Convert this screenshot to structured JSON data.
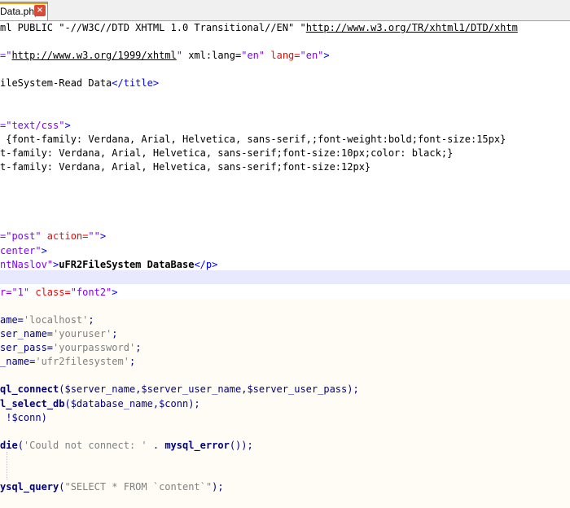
{
  "tab": {
    "label": "Data.php",
    "close_icon": "×"
  },
  "lines": [
    [
      {
        "t": "ml PUBLIC \"-//W3C//DTD XHTML 1.0 Transitional//EN\" ",
        "c": "plain"
      },
      {
        "t": "\"",
        "c": "plain"
      },
      {
        "t": "http://www.w3.org/TR/xhtml1/DTD/xhtm",
        "c": "url"
      }
    ],
    [],
    [
      {
        "t": "=\"",
        "c": "str"
      },
      {
        "t": "http://www.w3.org/1999/xhtml",
        "c": "url"
      },
      {
        "t": "\"",
        "c": "str"
      },
      {
        "t": " xml:lang=",
        "c": "plain"
      },
      {
        "t": "\"en\"",
        "c": "str"
      },
      {
        "t": " lang=",
        "c": "attr"
      },
      {
        "t": "\"en\"",
        "c": "str"
      },
      {
        "t": ">",
        "c": "tag"
      }
    ],
    [],
    [
      {
        "t": "ileSystem-Read Data",
        "c": "plain"
      },
      {
        "t": "</title>",
        "c": "tag"
      }
    ],
    [],
    [],
    [
      {
        "t": "=\"text/css\"",
        "c": "str"
      },
      {
        "t": ">",
        "c": "tag"
      }
    ],
    [
      {
        "t": " {font-family: Verdana, Arial, Helvetica, sans-serif,;font-weight:bold;font-size:15px}",
        "c": "plain"
      }
    ],
    [
      {
        "t": "t-family: Verdana, Arial, Helvetica, sans-serif;font-size:10px;color: black;}",
        "c": "plain"
      }
    ],
    [
      {
        "t": "t-family: Verdana, Arial, Helvetica, sans-serif;font-size:12px}",
        "c": "plain"
      }
    ],
    [],
    [],
    [],
    [],
    [
      {
        "t": "=\"post\"",
        "c": "str"
      },
      {
        "t": " action=",
        "c": "attr"
      },
      {
        "t": "\"\"",
        "c": "str"
      },
      {
        "t": ">",
        "c": "tag"
      }
    ],
    [
      {
        "t": "center\"",
        "c": "str"
      },
      {
        "t": ">",
        "c": "tag"
      }
    ],
    [
      {
        "t": "ntNaslov\"",
        "c": "str"
      },
      {
        "t": ">",
        "c": "tag"
      },
      {
        "t": "uFR2FileSystem DataBase",
        "c": "txt"
      },
      {
        "t": "</p>",
        "c": "tag"
      }
    ],
    [],
    [
      {
        "t": "r=\"1\"",
        "c": "str"
      },
      {
        "t": " class=",
        "c": "attr"
      },
      {
        "t": "\"font2\"",
        "c": "str"
      },
      {
        "t": ">",
        "c": "tag"
      }
    ],
    [],
    [
      {
        "t": "ame=",
        "c": "var"
      },
      {
        "t": "'localhost'",
        "c": "sq"
      },
      {
        "t": ";",
        "c": "var"
      }
    ],
    [
      {
        "t": "ser_name=",
        "c": "var"
      },
      {
        "t": "'youruser'",
        "c": "sq"
      },
      {
        "t": ";",
        "c": "var"
      }
    ],
    [
      {
        "t": "ser_pass=",
        "c": "var"
      },
      {
        "t": "'yourpassword'",
        "c": "sq"
      },
      {
        "t": ";",
        "c": "var"
      }
    ],
    [
      {
        "t": "_name=",
        "c": "var"
      },
      {
        "t": "'ufr2filesystem'",
        "c": "sq"
      },
      {
        "t": ";",
        "c": "var"
      }
    ],
    [],
    [
      {
        "t": "ql_connect",
        "c": "kw"
      },
      {
        "t": "($server_name,$server_user_name,$server_user_pass);",
        "c": "var"
      }
    ],
    [
      {
        "t": "l_select_db",
        "c": "kw"
      },
      {
        "t": "($database_name,$conn);",
        "c": "var"
      }
    ],
    [
      {
        "t": " !$conn)",
        "c": "var"
      }
    ],
    [],
    [
      {
        "t": "die",
        "c": "kw"
      },
      {
        "t": "(",
        "c": "var"
      },
      {
        "t": "'Could not connect: '",
        "c": "sq"
      },
      {
        "t": " . ",
        "c": "var"
      },
      {
        "t": "mysql_error",
        "c": "kw"
      },
      {
        "t": "());",
        "c": "var"
      }
    ],
    [],
    [],
    [
      {
        "t": "ysql_query",
        "c": "kw"
      },
      {
        "t": "(",
        "c": "var"
      },
      {
        "t": "\"SELECT * FROM `content`\"",
        "c": "sq"
      },
      {
        "t": ");",
        "c": "var"
      }
    ],
    []
  ]
}
